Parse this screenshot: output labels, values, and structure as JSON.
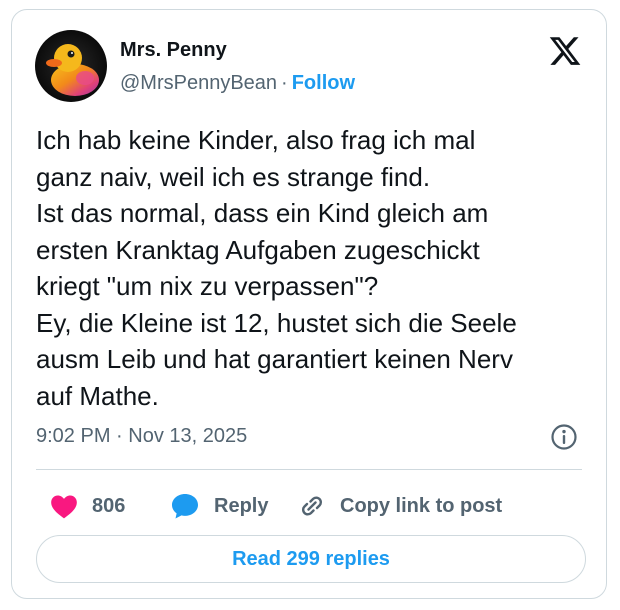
{
  "author": {
    "name": "Mrs. Penny",
    "handle": "@MrsPennyBean",
    "separator": "·",
    "follow_label": "Follow"
  },
  "tweet": {
    "text": "Ich hab keine Kinder, also frag ich mal\nganz naiv, weil ich es strange find.\nIst das normal, dass ein Kind gleich am\nersten Kranktag Aufgaben zugeschickt\nkriegt \"um nix zu verpassen\"?\nEy, die Kleine ist 12, hustet sich die Seele\nausm Leib und hat garantiert keinen Nerv\nauf Mathe.",
    "timestamp": "9:02 PM · Nov 13, 2025"
  },
  "actions": {
    "like_count": "806",
    "reply_label": "Reply",
    "copy_label": "Copy link to post"
  },
  "read_replies_label": "Read 299 replies",
  "icons": {
    "logo": "x-logo-icon",
    "info": "info-icon",
    "like": "heart-icon",
    "reply": "speech-bubble-icon",
    "copy": "link-icon"
  },
  "colors": {
    "accent": "#1d9bf0",
    "like": "#f91880",
    "muted": "#536471",
    "text": "#0f1419",
    "border": "#cfd9de"
  }
}
